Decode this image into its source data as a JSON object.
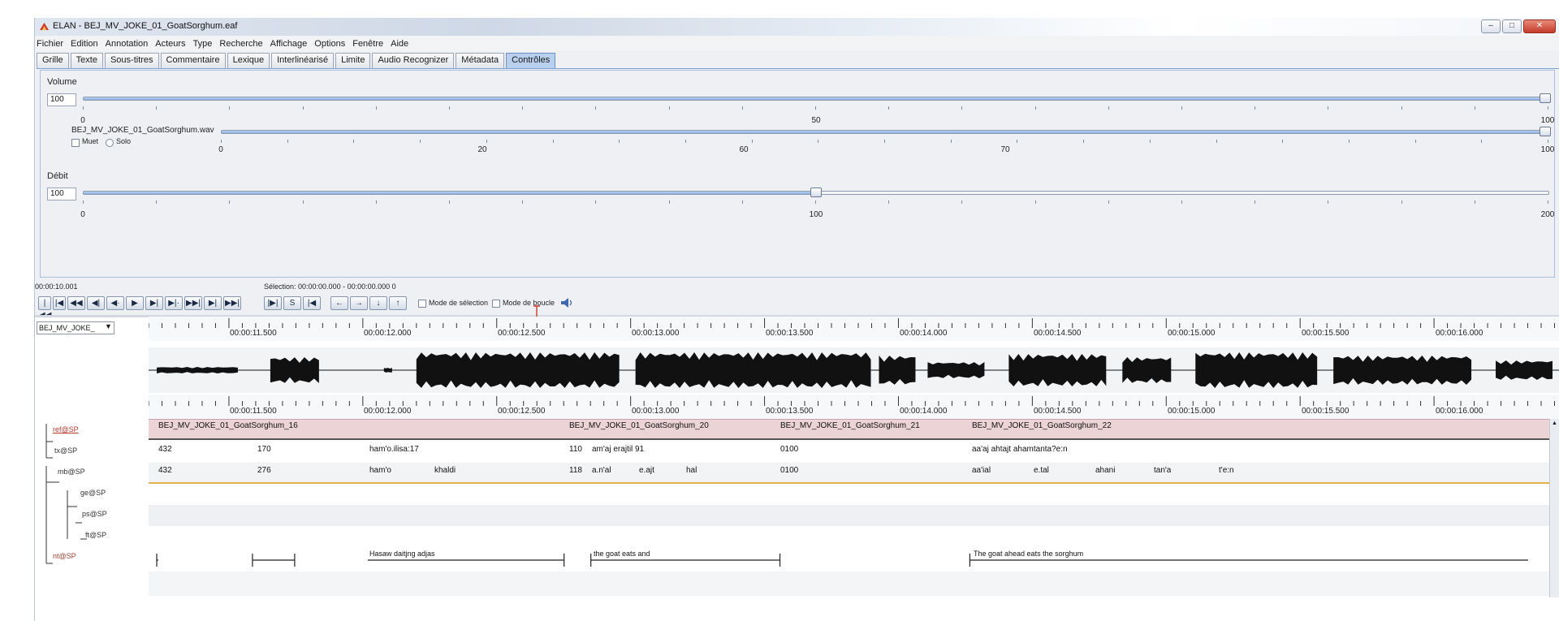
{
  "window": {
    "title": "ELAN - BEJ_MV_JOKE_01_GoatSorghum.eaf",
    "controls": [
      "–",
      "□",
      "✕"
    ]
  },
  "menu": [
    "Fichier",
    "Edition",
    "Annotation",
    "Acteurs",
    "Type",
    "Recherche",
    "Affichage",
    "Options",
    "Fenêtre",
    "Aide"
  ],
  "tabs": [
    "Grille",
    "Texte",
    "Sous-titres",
    "Commentaire",
    "Lexique",
    "Interlinéarisé",
    "Limite",
    "Audio Recognizer",
    "Métadata",
    "Contrôles"
  ],
  "active_tab": "Contrôles",
  "volume": {
    "label": "Volume",
    "value": "100",
    "level": 100,
    "ticks": [
      "0",
      "50",
      "100"
    ]
  },
  "media": {
    "label": "BEJ_MV_JOKE_01_GoatSorghum.wav",
    "mute_label": "Muet",
    "solo_label": "Solo",
    "level": 100,
    "ticks": [
      "0",
      "20",
      "60",
      "70",
      "100"
    ]
  },
  "rate": {
    "label": "Débit",
    "value": "100",
    "level": 50,
    "ticks": [
      "0",
      "100",
      "200"
    ]
  },
  "transport": {
    "time": "00:00:10.001",
    "selection": "Sélection: 00:00:00.000 - 00:00:00.000 0",
    "loop_label": "Mode de sélection",
    "loop_label2": "Mode de boucle",
    "buttons": [
      "|◀◀",
      "|◀",
      "◀◀",
      "◀|",
      "◀·",
      "▶",
      "▶|",
      "▶|·",
      "▶▶|",
      "▶|",
      "▶▶|"
    ],
    "sel_buttons": [
      "|▶|",
      "S",
      "|◀"
    ],
    "nav_buttons": [
      "←",
      "→",
      "↓",
      "↑"
    ]
  },
  "timeline": {
    "media_label": "BEJ_MV_JOKE_",
    "ruler_labels": [
      "00:00:11.500",
      "00:00:12.000",
      "00:00:12.500",
      "00:00:13.000",
      "00:00:13.500",
      "00:00:14.000",
      "00:00:14.500",
      "00:00:15.000",
      "00:00:15.500",
      "00:00:16.000"
    ],
    "tiers": [
      {
        "name": "ref@SP",
        "kind": "ref"
      },
      {
        "name": "tx@SP",
        "kind": "tx"
      },
      {
        "name": "mb@SP",
        "kind": "mb"
      },
      {
        "name": "ge@SP",
        "kind": "ge"
      },
      {
        "name": "ps@SP",
        "kind": "ps"
      },
      {
        "name": "ft@SP",
        "kind": "ft"
      },
      {
        "name": "nt@SP",
        "kind": "nt"
      }
    ],
    "ref_annotations": [
      "BEJ_MV_JOKE_01_GoatSorghum_16",
      "BEJ_MV_JOKE_01_GoatSorghum_20",
      "BEJ_MV_JOKE_01_GoatSorghum_21",
      "BEJ_MV_JOKE_01_GoatSorghum_22"
    ],
    "tx_annotations": [
      "432",
      "170",
      "ham'o.ilisa:17",
      "110",
      "am'aj erajtil 91",
      "0100",
      "aa'aj ahtajt ahamtanta?e:n"
    ],
    "mb_annotations": [
      "432",
      "276",
      "ham'o",
      "khaldi",
      "118",
      "a.n'al",
      "e.ajt",
      "hal",
      "0100",
      "aa'ial",
      "e.tal",
      "ahani",
      "tan'a",
      "t'e:n"
    ],
    "ft_annotations": [
      "Hasaw daitjng adjas",
      "the goat eats and",
      "The goat ahead eats the sorghum"
    ]
  }
}
